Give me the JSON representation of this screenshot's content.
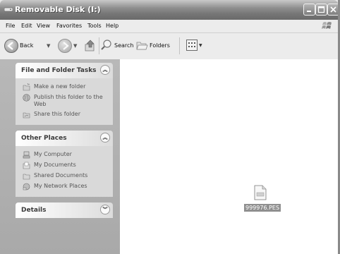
{
  "window": {
    "title": "Removable Disk (I:)"
  },
  "menu": {
    "file": "File",
    "edit": "Edit",
    "view": "View",
    "favorites": "Favorites",
    "tools": "Tools",
    "help": "Help"
  },
  "toolbar": {
    "back_label": "Back",
    "search_label": "Search",
    "folders_label": "Folders"
  },
  "panels": {
    "file_folder_tasks": {
      "title": "File and Folder Tasks",
      "items": [
        {
          "label": "Make a new folder",
          "icon": "new-folder-icon"
        },
        {
          "label": "Publish this folder to the Web",
          "icon": "globe-icon"
        },
        {
          "label": "Share this folder",
          "icon": "share-folder-icon"
        }
      ]
    },
    "other_places": {
      "title": "Other Places",
      "items": [
        {
          "label": "My Computer",
          "icon": "computer-icon"
        },
        {
          "label": "My Documents",
          "icon": "documents-icon"
        },
        {
          "label": "Shared Documents",
          "icon": "shared-folder-icon"
        },
        {
          "label": "My Network Places",
          "icon": "network-icon"
        }
      ]
    },
    "details": {
      "title": "Details"
    }
  },
  "files": [
    {
      "name": "999976.PES",
      "icon": "pes-file-icon"
    }
  ]
}
